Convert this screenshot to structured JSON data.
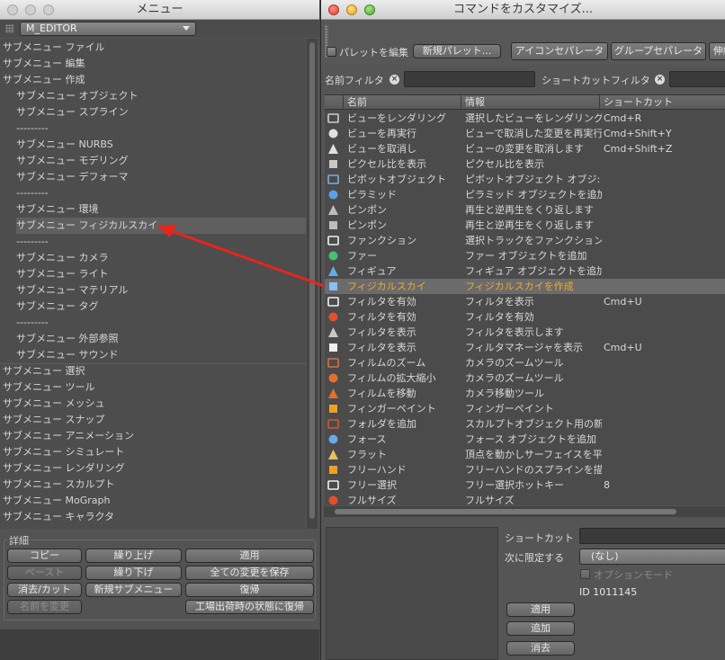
{
  "menu_window": {
    "title": "メニュー",
    "menu_select": "M_EDITOR",
    "items": [
      {
        "label": "サブメニュー ファイル",
        "level": 0
      },
      {
        "label": "サブメニュー 編集",
        "level": 0
      },
      {
        "label": "サブメニュー 作成",
        "level": 0
      },
      {
        "label": "サブメニュー オブジェクト",
        "level": 1
      },
      {
        "label": "サブメニュー スプライン",
        "level": 1
      },
      {
        "label": "---------",
        "level": 1
      },
      {
        "label": "サブメニュー NURBS",
        "level": 1
      },
      {
        "label": "サブメニュー モデリング",
        "level": 1
      },
      {
        "label": "サブメニュー デフォーマ",
        "level": 1
      },
      {
        "label": "---------",
        "level": 1
      },
      {
        "label": "サブメニュー 環境",
        "level": 1
      },
      {
        "label": "サブメニュー フィジカルスカイ",
        "level": 1,
        "selected": true
      },
      {
        "label": "---------",
        "level": 1
      },
      {
        "label": "サブメニュー カメラ",
        "level": 1
      },
      {
        "label": "サブメニュー ライト",
        "level": 1
      },
      {
        "label": "サブメニュー マテリアル",
        "level": 1
      },
      {
        "label": "サブメニュー タグ",
        "level": 1
      },
      {
        "label": "---------",
        "level": 1
      },
      {
        "label": "サブメニュー 外部参照",
        "level": 1
      },
      {
        "label": "サブメニュー サウンド",
        "level": 1
      },
      {
        "label": "サブメニュー 選択",
        "level": 0
      },
      {
        "label": "サブメニュー ツール",
        "level": 0
      },
      {
        "label": "サブメニュー メッシュ",
        "level": 0
      },
      {
        "label": "サブメニュー スナップ",
        "level": 0
      },
      {
        "label": "サブメニュー アニメーション",
        "level": 0
      },
      {
        "label": "サブメニュー シミュレート",
        "level": 0
      },
      {
        "label": "サブメニュー レンダリング",
        "level": 0
      },
      {
        "label": "サブメニュー スカルプト",
        "level": 0
      },
      {
        "label": "サブメニュー MoGraph",
        "level": 0
      },
      {
        "label": "サブメニュー キャラクタ",
        "level": 0
      }
    ],
    "detail_label": "詳細",
    "buttons": {
      "copy": "コピー",
      "move_up": "繰り上げ",
      "apply": "適用",
      "paste": "ペースト",
      "move_down": "繰り下げ",
      "save_all": "全ての変更を保存",
      "delete_cut": "消去/カット",
      "new_submenu": "新規サブメニュー",
      "revert": "復帰",
      "rename": "名前を変更",
      "factory_reset": "工場出荷時の状態に復帰"
    }
  },
  "cmd_window": {
    "title": "コマンドをカスタマイズ...",
    "edit_palette_label": "パレットを編集",
    "new_palette_button": "新規パレット...",
    "icon_separator_button": "アイコンセパレータ",
    "group_separator_button": "グループセパレータ",
    "stretch_button": "伸縮",
    "name_filter_label": "名前フィルタ",
    "shortcut_filter_label": "ショートカットフィルタ",
    "columns": {
      "name": "名前",
      "info": "情報",
      "shortcut": "ショートカット"
    },
    "rows": [
      {
        "icon": "render-view-icon",
        "color": "#d0d0d0",
        "name": "ビューをレンダリング",
        "info": "選択したビューをレンダリング",
        "shortcut": "Cmd+R"
      },
      {
        "icon": "redo-view-icon",
        "color": "#e0e0e0",
        "name": "ビューを再実行",
        "info": "ビューで取消した変更を再実行",
        "shortcut": "Cmd+Shift+Y"
      },
      {
        "icon": "undo-view-icon",
        "color": "#e0e0e0",
        "name": "ビューを取消し",
        "info": "ビューの変更を取消します",
        "shortcut": "Cmd+Shift+Z"
      },
      {
        "icon": "pixel-aspect-icon",
        "color": "#c8c8c8",
        "name": "ピクセル比を表示",
        "info": "ピクセル比を表示",
        "shortcut": ""
      },
      {
        "icon": "pivot-object-icon",
        "color": "#7ab0e0",
        "name": "ピボットオブジェクト",
        "info": "ピボットオブジェクト オブジ:",
        "shortcut": ""
      },
      {
        "icon": "pyramid-icon",
        "color": "#5aa0e8",
        "name": "ピラミッド",
        "info": "ピラミッド オブジェクトを追加",
        "shortcut": ""
      },
      {
        "icon": "ping-pong-icon",
        "color": "#bdbdbd",
        "name": "ピンポン",
        "info": "再生と逆再生をくり返します",
        "shortcut": ""
      },
      {
        "icon": "ping-pong-icon",
        "color": "#bdbdbd",
        "name": "ピンポン",
        "info": "再生と逆再生をくり返します",
        "shortcut": ""
      },
      {
        "icon": "function-icon",
        "color": "#f0f0f0",
        "name": "ファンクション",
        "info": "選択トラックをファンクション",
        "shortcut": ""
      },
      {
        "icon": "fur-icon",
        "color": "#48c070",
        "name": "ファー",
        "info": "ファー オブジェクトを追加",
        "shortcut": ""
      },
      {
        "icon": "figure-icon",
        "color": "#6aa8e8",
        "name": "フィギュア",
        "info": "フィギュア オブジェクトを追加",
        "shortcut": ""
      },
      {
        "icon": "physical-sky-icon",
        "color": "#8ac0f0",
        "name": "フィジカルスカイ",
        "info": "フィジカルスカイを作成",
        "shortcut": "",
        "highlight": true
      },
      {
        "icon": "filter-enable-icon",
        "color": "#f0f0f0",
        "name": "フィルタを有効",
        "info": "フィルタを表示",
        "shortcut": "Cmd+U"
      },
      {
        "icon": "filter-enable-red-icon",
        "color": "#e05030",
        "name": "フィルタを有効",
        "info": "フィルタを有効",
        "shortcut": ""
      },
      {
        "icon": "filter-show-icon",
        "color": "#c8c8c8",
        "name": "フィルタを表示",
        "info": "フィルタを表示します",
        "shortcut": ""
      },
      {
        "icon": "filter-show-icon",
        "color": "#f0f0f0",
        "name": "フィルタを表示",
        "info": "フィルタマネージャを表示",
        "shortcut": "Cmd+U"
      },
      {
        "icon": "film-zoom-icon",
        "color": "#e07030",
        "name": "フィルムのズーム",
        "info": "カメラのズームツール",
        "shortcut": ""
      },
      {
        "icon": "film-scale-icon",
        "color": "#e07030",
        "name": "フィルムの拡大縮小",
        "info": "カメラのズームツール",
        "shortcut": ""
      },
      {
        "icon": "film-move-icon",
        "color": "#e07030",
        "name": "フィルムを移動",
        "info": "カメラ移動ツール",
        "shortcut": ""
      },
      {
        "icon": "finger-paint-icon",
        "color": "#f0a020",
        "name": "フィンガーペイント",
        "info": "フィンガーペイント",
        "shortcut": ""
      },
      {
        "icon": "add-folder-icon",
        "color": "#e05030",
        "name": "フォルダを追加",
        "info": "スカルプトオブジェクト用の新",
        "shortcut": ""
      },
      {
        "icon": "force-icon",
        "color": "#6aa8e8",
        "name": "フォース",
        "info": "フォース オブジェクトを追加",
        "shortcut": ""
      },
      {
        "icon": "flatten-icon",
        "color": "#e8c060",
        "name": "フラット",
        "info": "頂点を動かしサーフェイスを平",
        "shortcut": ""
      },
      {
        "icon": "freehand-icon",
        "color": "#f0a020",
        "name": "フリーハンド",
        "info": "フリーハンドのスプラインを描",
        "shortcut": ""
      },
      {
        "icon": "free-select-icon",
        "color": "#f0f0f0",
        "name": "フリー選択",
        "info": "フリー選択ホットキー",
        "shortcut": "8"
      },
      {
        "icon": "full-size-icon",
        "color": "#e05030",
        "name": "フルサイズ",
        "info": "フルサイズ",
        "shortcut": ""
      }
    ],
    "bottom": {
      "shortcut_label": "ショートカット",
      "restrict_label": "次に限定する",
      "restrict_value": "(なし)",
      "option_mode_label": "オプションモード",
      "id_text": "ID 1011145",
      "apply_button": "適用",
      "add_button": "追加",
      "delete_button": "消去"
    }
  }
}
